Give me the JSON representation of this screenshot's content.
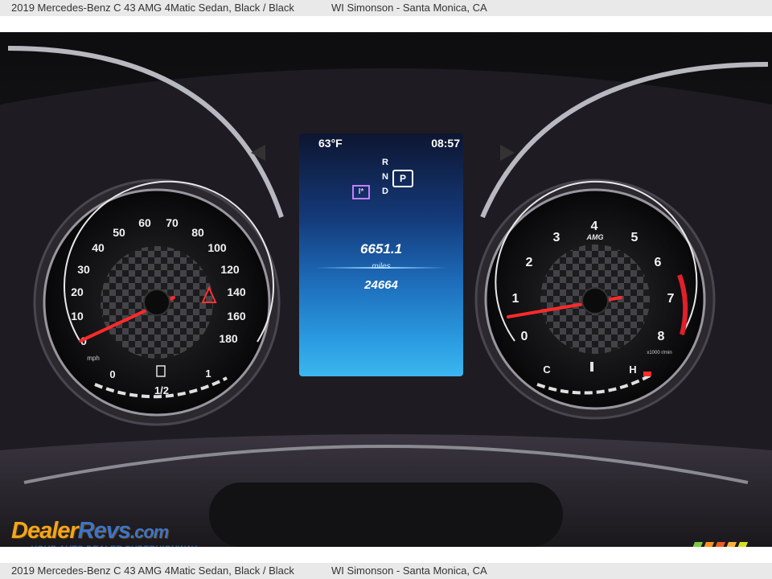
{
  "caption": {
    "vehicle": "2019 Mercedes-Benz C 43 AMG 4Matic Sedan,  Black / Black",
    "dealer": "WI Simonson - Santa Monica, CA"
  },
  "speedometer": {
    "ticks": [
      "0",
      "10",
      "20",
      "30",
      "40",
      "50",
      "60",
      "70",
      "80",
      "100",
      "120",
      "140",
      "160",
      "180"
    ],
    "unit": "mph",
    "fuel_labels": [
      "0",
      "1/2",
      "1"
    ]
  },
  "tachometer": {
    "ticks": [
      "0",
      "1",
      "2",
      "3",
      "4",
      "5",
      "6",
      "7",
      "8"
    ],
    "brand": "AMG",
    "unit": "x1000 r/min",
    "temp_labels": [
      "C",
      "H"
    ]
  },
  "display": {
    "temperature": "63°F",
    "time": "08:57",
    "gears": [
      "R",
      "N",
      "D"
    ],
    "gear_selected": "P",
    "trip": "6651.1",
    "trip_unit": "miles",
    "odometer": "24664",
    "mode_badge": "I*"
  },
  "watermark": {
    "brand_part1": "Dealer",
    "brand_part2": "Revs",
    "brand_part3": ".com",
    "tagline": "YOUR AUTO DEALER SUPERHIGHWAY"
  },
  "colors": {
    "needle": "#ff2a2a",
    "redline": "#e0202a",
    "screen_blue": "#1d6ab8"
  }
}
